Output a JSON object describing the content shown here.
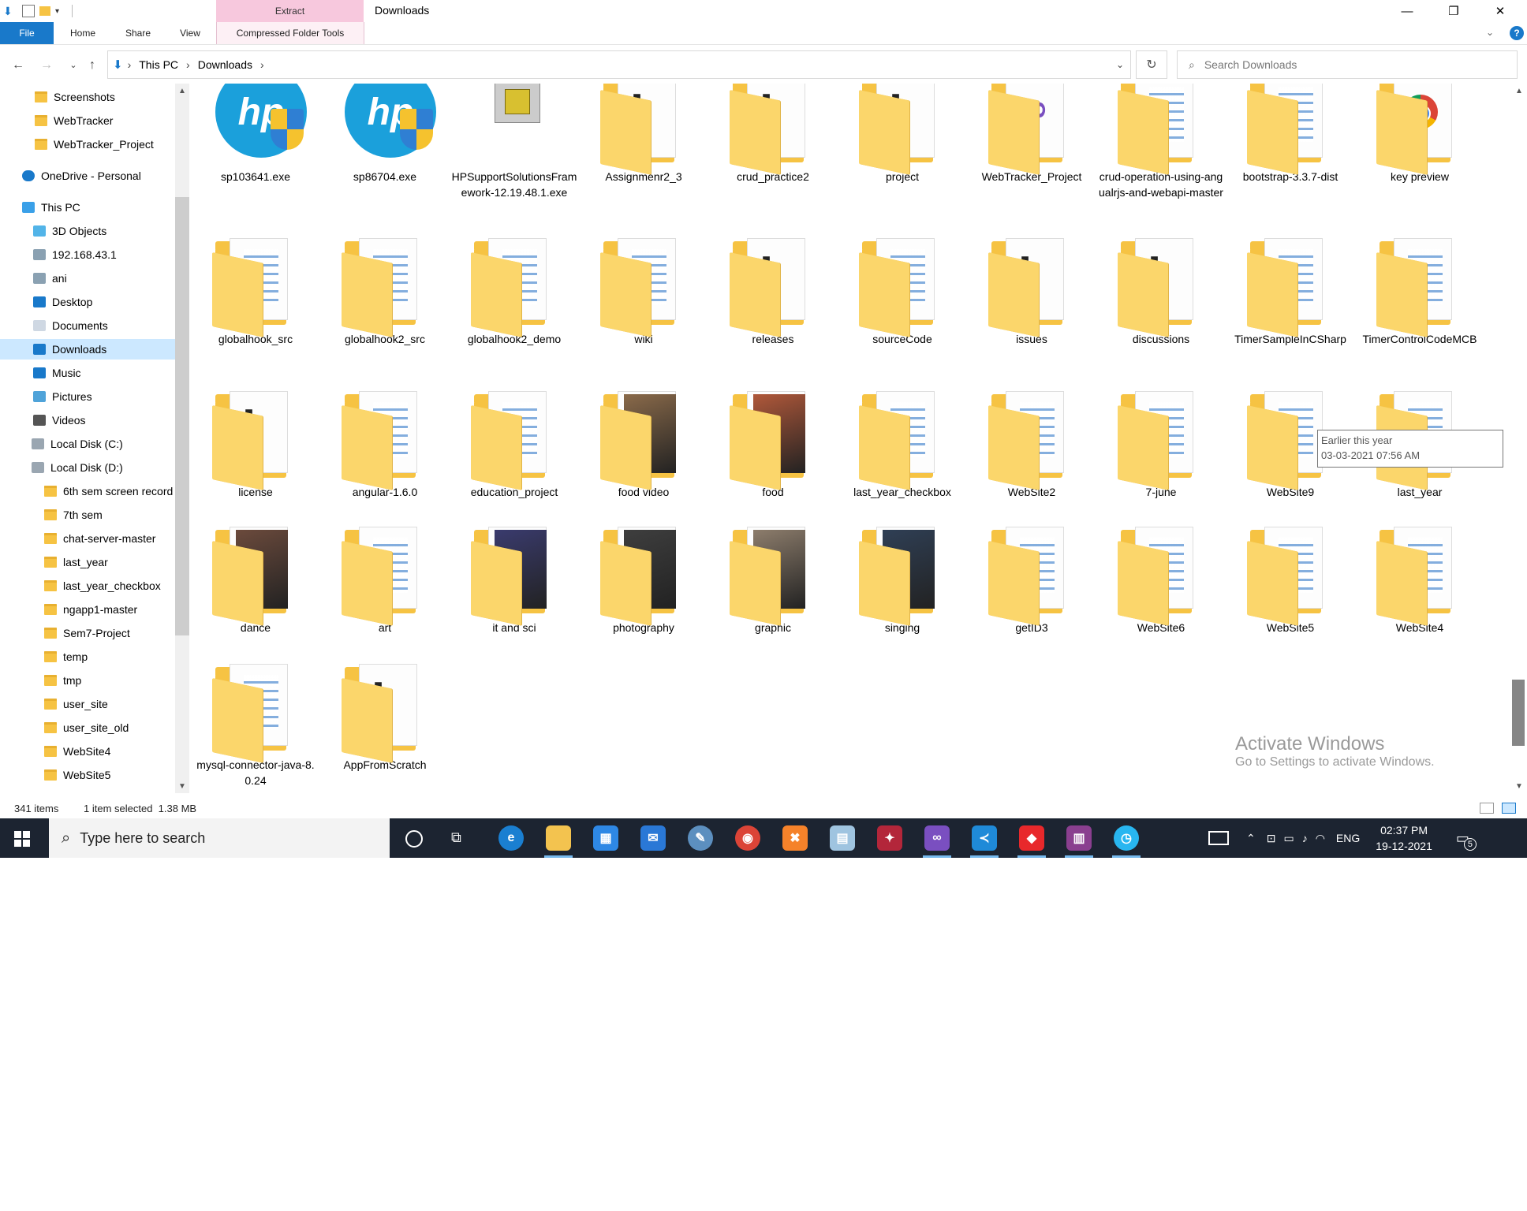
{
  "window": {
    "title": "Downloads",
    "context_group": "Extract",
    "controls": {
      "minimize": "—",
      "maximize": "❐",
      "close": "✕"
    }
  },
  "ribbon": {
    "tabs": [
      "File",
      "Home",
      "Share",
      "View",
      "Compressed Folder Tools"
    ],
    "help": "?"
  },
  "address": {
    "breadcrumb": [
      "This PC",
      "Downloads"
    ],
    "search_placeholder": "Search Downloads"
  },
  "nav": {
    "items": [
      {
        "label": "Screenshots",
        "icon": "folder-icon"
      },
      {
        "label": "WebTracker",
        "icon": "folder-icon"
      },
      {
        "label": "WebTracker_Project",
        "icon": "folder-icon"
      },
      {
        "label": "OneDrive - Personal",
        "icon": "cloud-icon"
      },
      {
        "label": "This PC",
        "icon": "pc-icon"
      },
      {
        "label": "3D Objects",
        "icon": "cube-icon"
      },
      {
        "label": "192.168.43.1",
        "icon": "network-drive-icon"
      },
      {
        "label": "ani",
        "icon": "network-drive-icon"
      },
      {
        "label": "Desktop",
        "icon": "desktop-icon"
      },
      {
        "label": "Documents",
        "icon": "document-icon"
      },
      {
        "label": "Downloads",
        "icon": "download-icon",
        "selected": true
      },
      {
        "label": "Music",
        "icon": "music-icon"
      },
      {
        "label": "Pictures",
        "icon": "pictures-icon"
      },
      {
        "label": "Videos",
        "icon": "video-icon"
      },
      {
        "label": "Local Disk (C:)",
        "icon": "drive-icon"
      },
      {
        "label": "Local Disk (D:)",
        "icon": "drive-icon"
      },
      {
        "label": "6th sem screen record",
        "icon": "folder-icon"
      },
      {
        "label": "7th sem",
        "icon": "folder-icon"
      },
      {
        "label": "chat-server-master",
        "icon": "folder-icon"
      },
      {
        "label": "last_year",
        "icon": "folder-icon"
      },
      {
        "label": "last_year_checkbox",
        "icon": "folder-icon"
      },
      {
        "label": "ngapp1-master",
        "icon": "folder-icon"
      },
      {
        "label": "Sem7-Project",
        "icon": "folder-icon"
      },
      {
        "label": "temp",
        "icon": "folder-icon"
      },
      {
        "label": "tmp",
        "icon": "folder-icon"
      },
      {
        "label": "user_site",
        "icon": "folder-icon"
      },
      {
        "label": "user_site_old",
        "icon": "folder-icon"
      },
      {
        "label": "WebSite4",
        "icon": "folder-icon"
      },
      {
        "label": "WebSite5",
        "icon": "folder-icon"
      }
    ]
  },
  "files": [
    {
      "name": "sp103641.exe",
      "kind": "hp-exe"
    },
    {
      "name": "sp86704.exe",
      "kind": "hp-exe"
    },
    {
      "name": "HPSupportSolutionsFramework-12.19.48.1.exe",
      "kind": "installer"
    },
    {
      "name": "Assignmenr2_3",
      "kind": "folder-code"
    },
    {
      "name": "crud_practice2",
      "kind": "folder-code"
    },
    {
      "name": "project",
      "kind": "folder-code"
    },
    {
      "name": "WebTracker_Project",
      "kind": "folder-vs"
    },
    {
      "name": "crud-operation-using-angualrjs-and-webapi-master",
      "kind": "folder-doc"
    },
    {
      "name": "bootstrap-3.3.7-dist",
      "kind": "folder-doc"
    },
    {
      "name": "key preview",
      "kind": "folder-chrome"
    },
    {
      "name": "globalhook_src",
      "kind": "folder-doc"
    },
    {
      "name": "globalhook2_src",
      "kind": "folder-doc"
    },
    {
      "name": "globalhook2_demo",
      "kind": "folder-doc"
    },
    {
      "name": "wiki",
      "kind": "folder-doc"
    },
    {
      "name": "releases",
      "kind": "folder-code"
    },
    {
      "name": "sourceCode",
      "kind": "folder-doc"
    },
    {
      "name": "issues",
      "kind": "folder-code"
    },
    {
      "name": "discussions",
      "kind": "folder-code"
    },
    {
      "name": "TimerSampleInCSharp",
      "kind": "folder-doc"
    },
    {
      "name": "TimerControlCodeMCB",
      "kind": "folder-doc"
    },
    {
      "name": "license",
      "kind": "folder-code"
    },
    {
      "name": "angular-1.6.0",
      "kind": "folder-doc"
    },
    {
      "name": "education_project",
      "kind": "folder-doc"
    },
    {
      "name": "food video",
      "kind": "folder-photo",
      "color": "#8a6a4a"
    },
    {
      "name": "food",
      "kind": "folder-photo",
      "color": "#b0583a"
    },
    {
      "name": "last_year_checkbox",
      "kind": "folder-doc"
    },
    {
      "name": "WebSite2",
      "kind": "folder-doc"
    },
    {
      "name": "7-june",
      "kind": "folder-doc"
    },
    {
      "name": "WebSite9",
      "kind": "folder-doc"
    },
    {
      "name": "last_year",
      "kind": "folder-doc"
    },
    {
      "name": "dance",
      "kind": "folder-photo",
      "color": "#6b4a3c"
    },
    {
      "name": "art",
      "kind": "folder-doc"
    },
    {
      "name": "it and sci",
      "kind": "folder-photo",
      "color": "#3a3b6e"
    },
    {
      "name": "photography",
      "kind": "folder-photo",
      "color": "#3e3e3e"
    },
    {
      "name": "graphic",
      "kind": "folder-photo",
      "color": "#8d7d6c"
    },
    {
      "name": "singing",
      "kind": "folder-photo",
      "color": "#2f3f55"
    },
    {
      "name": "getID3",
      "kind": "folder-doc"
    },
    {
      "name": "WebSite6",
      "kind": "folder-doc"
    },
    {
      "name": "WebSite5",
      "kind": "folder-doc"
    },
    {
      "name": "WebSite4",
      "kind": "folder-doc"
    },
    {
      "name": "mysql-connector-java-8.0.24",
      "kind": "folder-doc"
    },
    {
      "name": "AppFromScratch",
      "kind": "folder-code"
    }
  ],
  "tooltip": {
    "line1": "Earlier this year",
    "line2": "03-03-2021 07:56 AM"
  },
  "watermark": {
    "line1": "Activate Windows",
    "line2": "Go to Settings to activate Windows."
  },
  "status": {
    "count": "341 items",
    "selection": "1 item selected  1.38 MB"
  },
  "taskbar": {
    "search_placeholder": "Type here to search",
    "language": "ENG",
    "time": "02:37 PM",
    "date": "19-12-2021",
    "notification_count": "5"
  },
  "colors": {
    "accent": "#1979ca",
    "selected": "#cce8ff",
    "taskbar": "#1c2431",
    "folder": "#f6c343"
  }
}
